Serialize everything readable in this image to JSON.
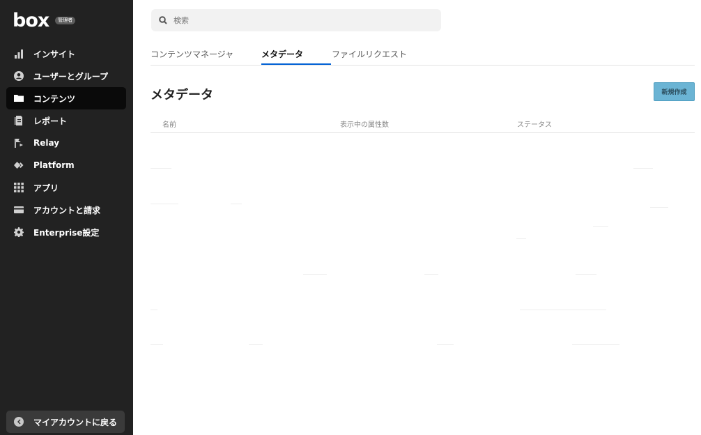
{
  "brand": {
    "logo": "box",
    "badge": "管理者"
  },
  "sidebar": {
    "items": [
      {
        "label": "インサイト",
        "icon": "bar-chart-icon"
      },
      {
        "label": "ユーザーとグループ",
        "icon": "user-icon"
      },
      {
        "label": "コンテンツ",
        "icon": "folder-icon",
        "active": true
      },
      {
        "label": "レポート",
        "icon": "report-icon"
      },
      {
        "label": "Relay",
        "icon": "relay-icon"
      },
      {
        "label": "Platform",
        "icon": "platform-icon"
      },
      {
        "label": "アプリ",
        "icon": "apps-grid-icon"
      },
      {
        "label": "アカウントと請求",
        "icon": "card-icon"
      },
      {
        "label": "Enterprise設定",
        "icon": "gear-icon"
      }
    ],
    "back_label": "マイアカウントに戻る"
  },
  "search": {
    "placeholder": "検索"
  },
  "tabs": [
    {
      "label": "コンテンツマネージャ"
    },
    {
      "label": "メタデータ",
      "active": true
    },
    {
      "label": "ファイルリクエスト"
    }
  ],
  "main": {
    "title": "メタデータ",
    "new_button": "新規作成",
    "columns": [
      "名前",
      "表示中の属性数",
      "ステータス"
    ]
  },
  "colors": {
    "sidebar_bg": "#222222",
    "accent": "#0061d5",
    "button_bg": "#6bb4d4"
  }
}
